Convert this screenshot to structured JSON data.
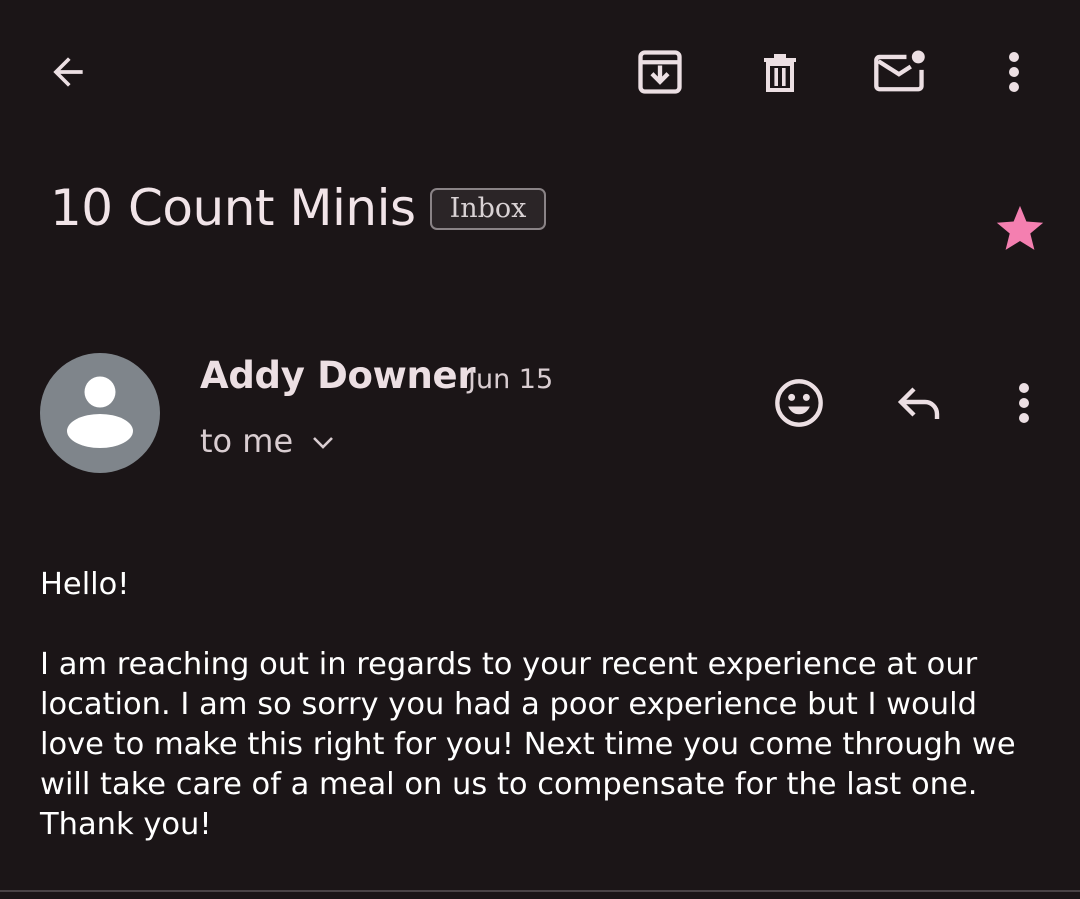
{
  "toolbar": {
    "back_icon": "arrow-left-icon",
    "archive_icon": "archive-icon",
    "delete_icon": "trash-icon",
    "mark_unread_icon": "mail-unread-icon",
    "more_icon": "more-vertical-icon"
  },
  "email": {
    "subject": "10 Count Minis",
    "label": "Inbox",
    "starred": true,
    "star_color": "#f47fb0"
  },
  "message": {
    "sender": "Addy Downer",
    "date": "Jun 15",
    "recipient": "to me",
    "avatar_color": "#7f858b",
    "actions": {
      "react_icon": "emoji-icon",
      "reply_icon": "reply-icon",
      "more_icon": "more-vertical-icon"
    },
    "body": {
      "greeting": "Hello!",
      "paragraph": "I am reaching out in regards to your recent experience at our location. I am so sorry you had a poor experience but I would love to make this right for you! Next time you come through we will take care of a meal on us to compensate for the last one. Thank you!"
    }
  },
  "colors": {
    "background": "#1b1517",
    "icon": "#ecdfe3",
    "text": "#ffffff"
  }
}
